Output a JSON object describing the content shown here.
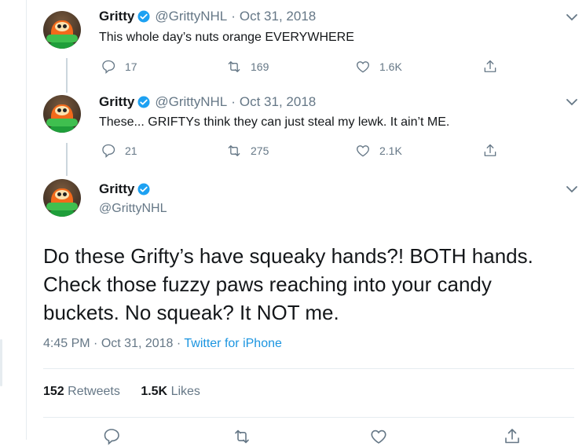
{
  "tweets": [
    {
      "name": "Gritty",
      "handle": "@GrittyNHL",
      "date": "Oct 31, 2018",
      "text": "This whole day’s nuts orange EVERYWHERE",
      "replies": "17",
      "retweets": "169",
      "likes": "1.6K"
    },
    {
      "name": "Gritty",
      "handle": "@GrittyNHL",
      "date": "Oct 31, 2018",
      "text": "These... GRIFTYs think they can just steal my lewk. It ain’t ME.",
      "replies": "21",
      "retweets": "275",
      "likes": "2.1K"
    }
  ],
  "main_tweet": {
    "name": "Gritty",
    "handle": "@GrittyNHL",
    "text_lines": [
      "Do these Grifty’s have squeaky hands?! BOTH hands.",
      "Check those fuzzy paws reaching into your candy",
      "buckets. No squeak? It NOT me."
    ],
    "time": "4:45 PM",
    "date": "Oct 31, 2018",
    "source": "Twitter for iPhone",
    "retweet_count": "152",
    "retweet_label": "Retweets",
    "like_count": "1.5K",
    "like_label": "Likes"
  },
  "separator": "·",
  "colors": {
    "accent": "#1da1f2",
    "link": "#1b95e0",
    "muted": "#657786",
    "text": "#14171a",
    "border": "#e6ecf0"
  },
  "icons": [
    "reply-icon",
    "retweet-icon",
    "like-icon",
    "share-icon",
    "verified-badge-icon",
    "chevron-down-icon"
  ]
}
